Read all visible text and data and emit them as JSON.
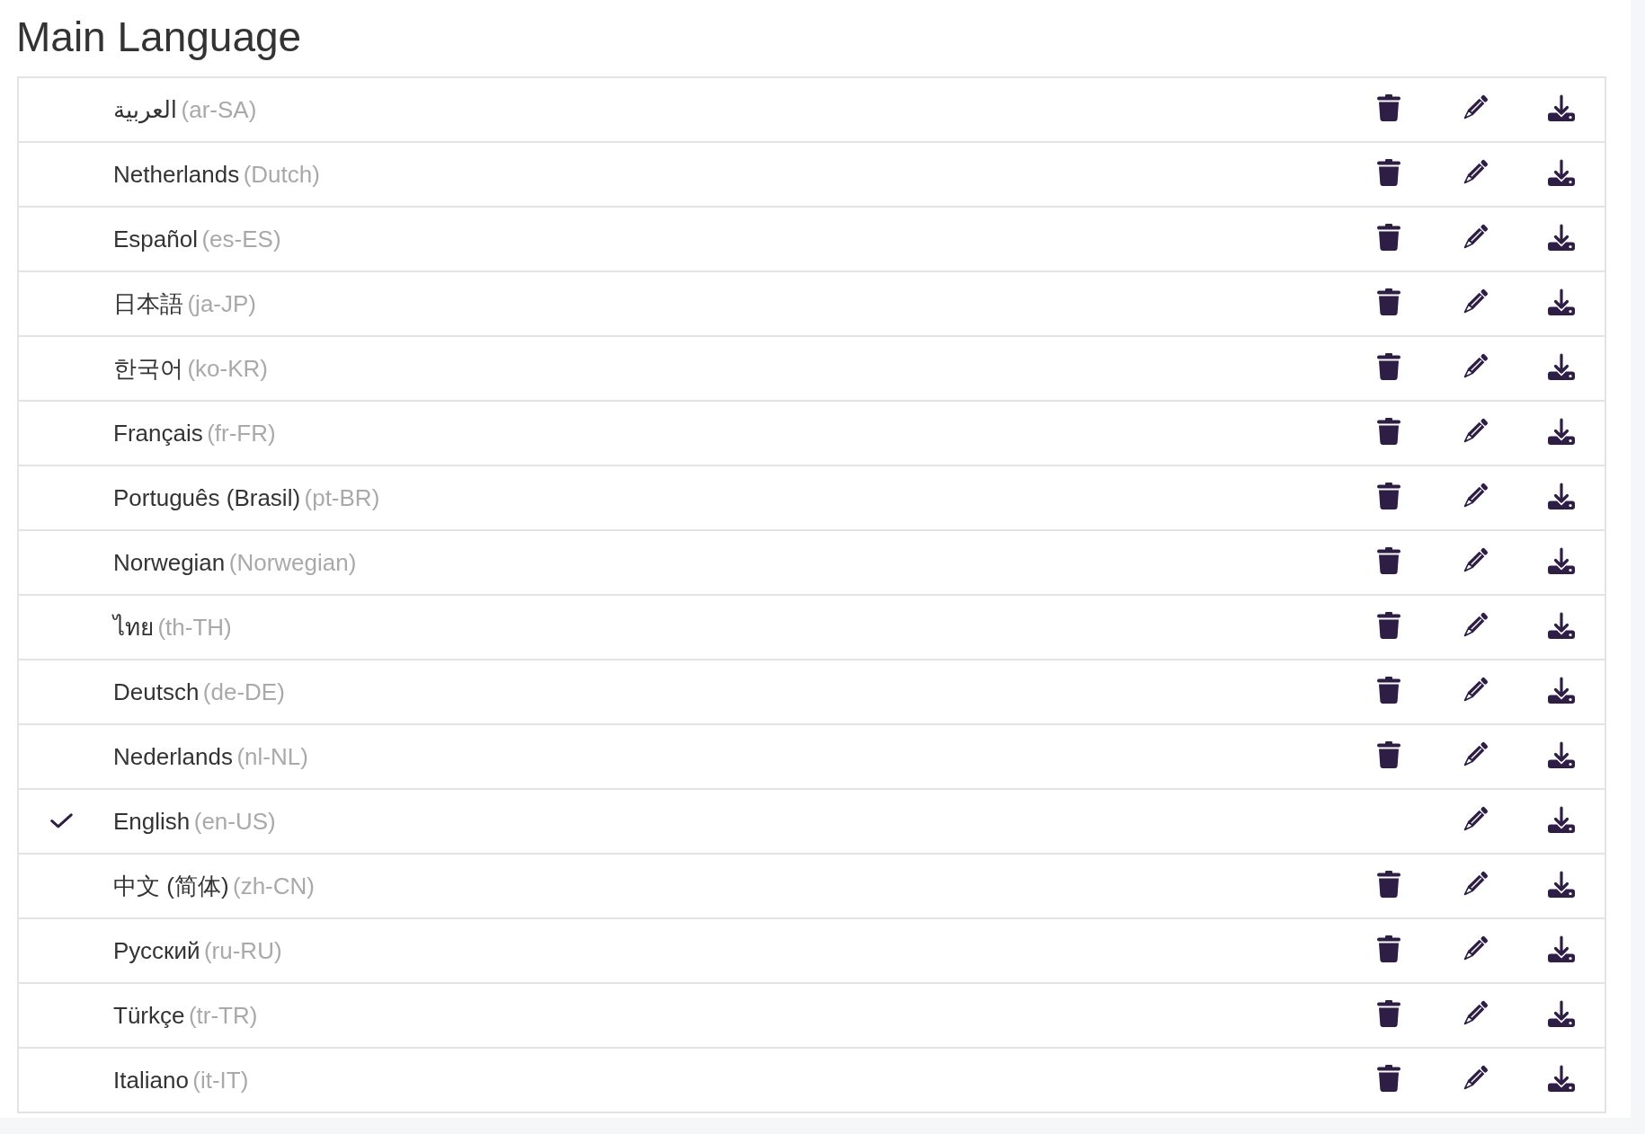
{
  "title": "Main Language",
  "languages": [
    {
      "name": "العربية",
      "code": "(ar-SA)",
      "selected": false,
      "deletable": true
    },
    {
      "name": "Netherlands",
      "code": "(Dutch)",
      "selected": false,
      "deletable": true
    },
    {
      "name": "Español",
      "code": "(es-ES)",
      "selected": false,
      "deletable": true
    },
    {
      "name": "日本語",
      "code": "(ja-JP)",
      "selected": false,
      "deletable": true
    },
    {
      "name": "한국어",
      "code": "(ko-KR)",
      "selected": false,
      "deletable": true
    },
    {
      "name": "Français",
      "code": "(fr-FR)",
      "selected": false,
      "deletable": true
    },
    {
      "name": "Português (Brasil)",
      "code": "(pt-BR)",
      "selected": false,
      "deletable": true
    },
    {
      "name": "Norwegian",
      "code": "(Norwegian)",
      "selected": false,
      "deletable": true
    },
    {
      "name": "ไทย",
      "code": "(th-TH)",
      "selected": false,
      "deletable": true
    },
    {
      "name": "Deutsch",
      "code": "(de-DE)",
      "selected": false,
      "deletable": true
    },
    {
      "name": "Nederlands",
      "code": "(nl-NL)",
      "selected": false,
      "deletable": true
    },
    {
      "name": "English",
      "code": "(en-US)",
      "selected": true,
      "deletable": false
    },
    {
      "name": "中文 (简体)",
      "code": "(zh-CN)",
      "selected": false,
      "deletable": true
    },
    {
      "name": "Русский",
      "code": "(ru-RU)",
      "selected": false,
      "deletable": true
    },
    {
      "name": "Türkçe",
      "code": "(tr-TR)",
      "selected": false,
      "deletable": true
    },
    {
      "name": "Italiano",
      "code": "(it-IT)",
      "selected": false,
      "deletable": true
    }
  ]
}
